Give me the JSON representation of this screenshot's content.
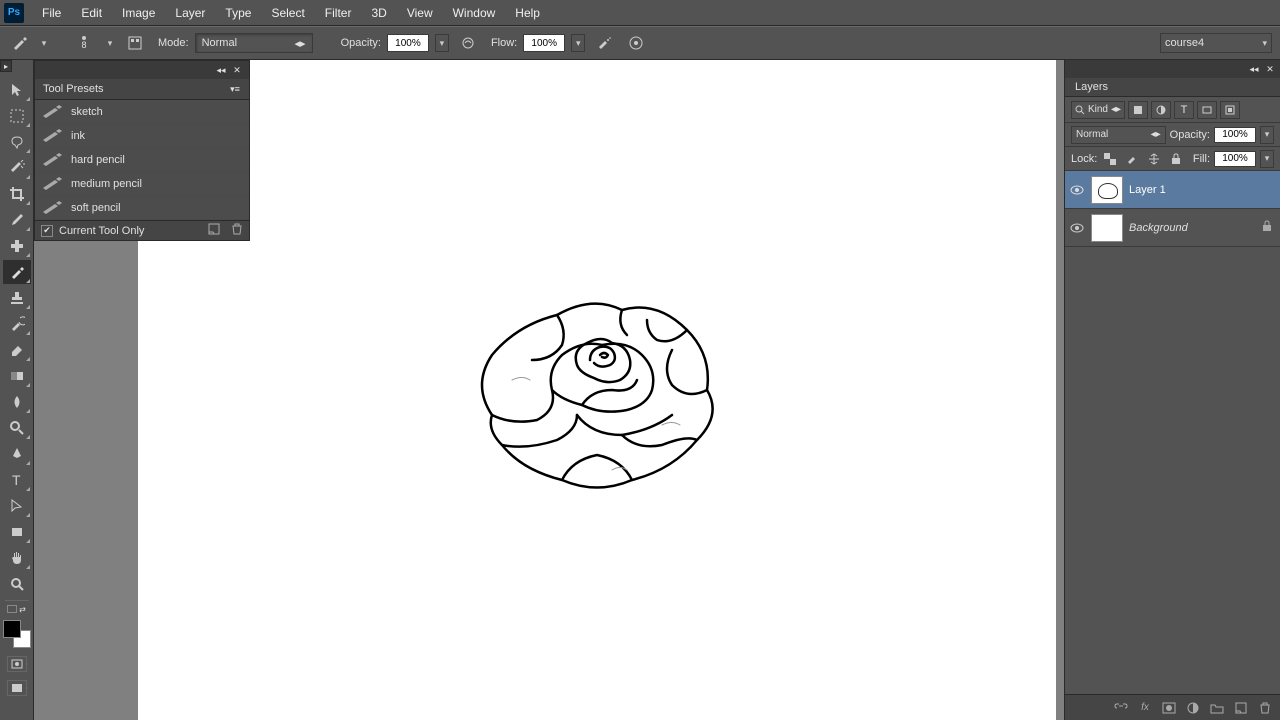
{
  "menubar": {
    "items": [
      "File",
      "Edit",
      "Image",
      "Layer",
      "Type",
      "Select",
      "Filter",
      "3D",
      "View",
      "Window",
      "Help"
    ]
  },
  "options": {
    "brush_size": "8",
    "mode_label": "Mode:",
    "mode_value": "Normal",
    "opacity_label": "Opacity:",
    "opacity_value": "100%",
    "flow_label": "Flow:",
    "flow_value": "100%",
    "doc_name": "course4"
  },
  "presets": {
    "title": "Tool Presets",
    "items": [
      "sketch",
      "ink",
      "hard pencil",
      "medium pencil",
      "soft pencil"
    ],
    "footer_label": "Current Tool Only",
    "footer_checked": true
  },
  "layers": {
    "tab": "Layers",
    "filter_kind": "Kind",
    "blend_mode": "Normal",
    "opacity_label": "Opacity:",
    "opacity_value": "100%",
    "lock_label": "Lock:",
    "fill_label": "Fill:",
    "fill_value": "100%",
    "items": [
      {
        "name": "Layer 1",
        "selected": true,
        "drawing": true,
        "locked": false
      },
      {
        "name": "Background",
        "selected": false,
        "drawing": false,
        "locked": true
      }
    ]
  }
}
